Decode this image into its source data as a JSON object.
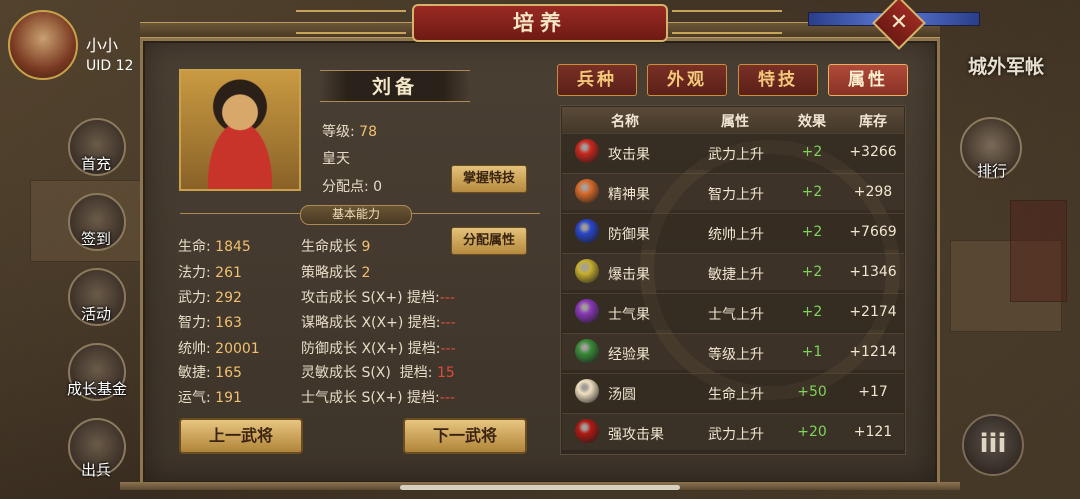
{
  "player": {
    "name": "小小",
    "uid": "UID  12"
  },
  "side_menu": [
    {
      "label": "首充",
      "icon": "first-recharge-icon"
    },
    {
      "label": "签到",
      "icon": "sign-in-icon"
    },
    {
      "label": "活动",
      "icon": "activity-icon"
    },
    {
      "label": "成长基金",
      "icon": "growth-fund-icon"
    },
    {
      "label": "出兵",
      "icon": "dispatch-icon"
    }
  ],
  "right_menu": {
    "city_label": "城外军帐",
    "rank_label": "排行",
    "menu_icon": "iii"
  },
  "window": {
    "title": "培养",
    "close": "✕"
  },
  "hero": {
    "name": "刘备",
    "level_label": "等级:",
    "level": "78",
    "title": "皇天",
    "points_label": "分配点:",
    "points": "0",
    "master_skill_btn": "掌握特技",
    "allocate_btn": "分配属性",
    "section_label": "基本能力"
  },
  "stats_left": [
    {
      "label": "生命:",
      "value": "1845"
    },
    {
      "label": "法力:",
      "value": "261"
    },
    {
      "label": "武力:",
      "value": "292"
    },
    {
      "label": "智力:",
      "value": "163"
    },
    {
      "label": "统帅:",
      "value": "20001"
    },
    {
      "label": "敏捷:",
      "value": "165"
    },
    {
      "label": "运气:",
      "value": "191"
    }
  ],
  "stats_right": [
    {
      "label": "生命成长",
      "value": "9",
      "extra": "",
      "tier": ""
    },
    {
      "label": "策略成长",
      "value": "2",
      "extra": "",
      "tier": ""
    },
    {
      "label": "攻击成长",
      "value": "S(X+)",
      "extra": "提档:",
      "tier": "---"
    },
    {
      "label": "谋略成长",
      "value": "X(X+)",
      "extra": "提档:",
      "tier": "---"
    },
    {
      "label": "防御成长",
      "value": "X(X+)",
      "extra": "提档:",
      "tier": "---"
    },
    {
      "label": "灵敏成长",
      "value": "S(X)",
      "extra": "提档:",
      "tier": "15"
    },
    {
      "label": "士气成长",
      "value": "S(X+)",
      "extra": "提档:",
      "tier": "---"
    }
  ],
  "nav": {
    "prev": "上一武将",
    "next": "下一武将"
  },
  "tabs": [
    {
      "label": "兵种",
      "active": false
    },
    {
      "label": "外观",
      "active": false
    },
    {
      "label": "特技",
      "active": false
    },
    {
      "label": "属性",
      "active": true
    }
  ],
  "table": {
    "headers": [
      "名称",
      "属性",
      "效果",
      "库存"
    ],
    "rows": [
      {
        "icon": "attack-fruit-icon",
        "color": "#c8281e",
        "name": "攻击果",
        "attr": "武力上升",
        "effect": "+2",
        "stock": "+3266"
      },
      {
        "icon": "spirit-fruit-icon",
        "color": "#d86a2a",
        "name": "精神果",
        "attr": "智力上升",
        "effect": "+2",
        "stock": "+298"
      },
      {
        "icon": "defense-fruit-icon",
        "color": "#2a46c8",
        "name": "防御果",
        "attr": "统帅上升",
        "effect": "+2",
        "stock": "+7669"
      },
      {
        "icon": "burst-fruit-icon",
        "color": "#c8b030",
        "name": "爆击果",
        "attr": "敏捷上升",
        "effect": "+2",
        "stock": "+1346"
      },
      {
        "icon": "morale-fruit-icon",
        "color": "#8a38b8",
        "name": "士气果",
        "attr": "士气上升",
        "effect": "+2",
        "stock": "+2174"
      },
      {
        "icon": "exp-fruit-icon",
        "color": "#3a8a3a",
        "name": "经验果",
        "attr": "等级上升",
        "effect": "+1",
        "stock": "+1214"
      },
      {
        "icon": "tangyuan-icon",
        "color": "#f0e0c0",
        "name": "汤圆",
        "attr": "生命上升",
        "effect": "+50",
        "stock": "+17"
      },
      {
        "icon": "strong-attack-fruit-icon",
        "color": "#b01a14",
        "name": "强攻击果",
        "attr": "武力上升",
        "effect": "+20",
        "stock": "+121"
      }
    ]
  }
}
